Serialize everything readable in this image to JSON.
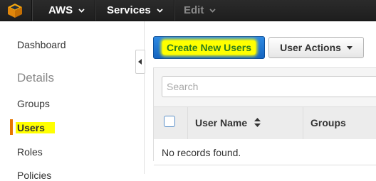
{
  "topbar": {
    "logo_icon": "aws-cube-icon",
    "account_label": "AWS",
    "services_label": "Services",
    "edit_label": "Edit",
    "background": "#222222",
    "logo_color": "#f7a80d"
  },
  "sidebar": {
    "dashboard": "Dashboard",
    "details_heading": "Details",
    "items": [
      {
        "label": "Groups",
        "active": false
      },
      {
        "label": "Users",
        "active": true
      },
      {
        "label": "Roles",
        "active": false
      },
      {
        "label": "Policies",
        "active": false
      }
    ],
    "active_color": "#e77600",
    "highlight_color": "#ffff00"
  },
  "toolbar": {
    "create_label": "Create New Users",
    "actions_label": "User Actions",
    "primary_color": "#1e74d2"
  },
  "search": {
    "placeholder": "Search",
    "value": ""
  },
  "table": {
    "columns": [
      "User Name",
      "Groups"
    ],
    "empty_message": "No records found."
  }
}
